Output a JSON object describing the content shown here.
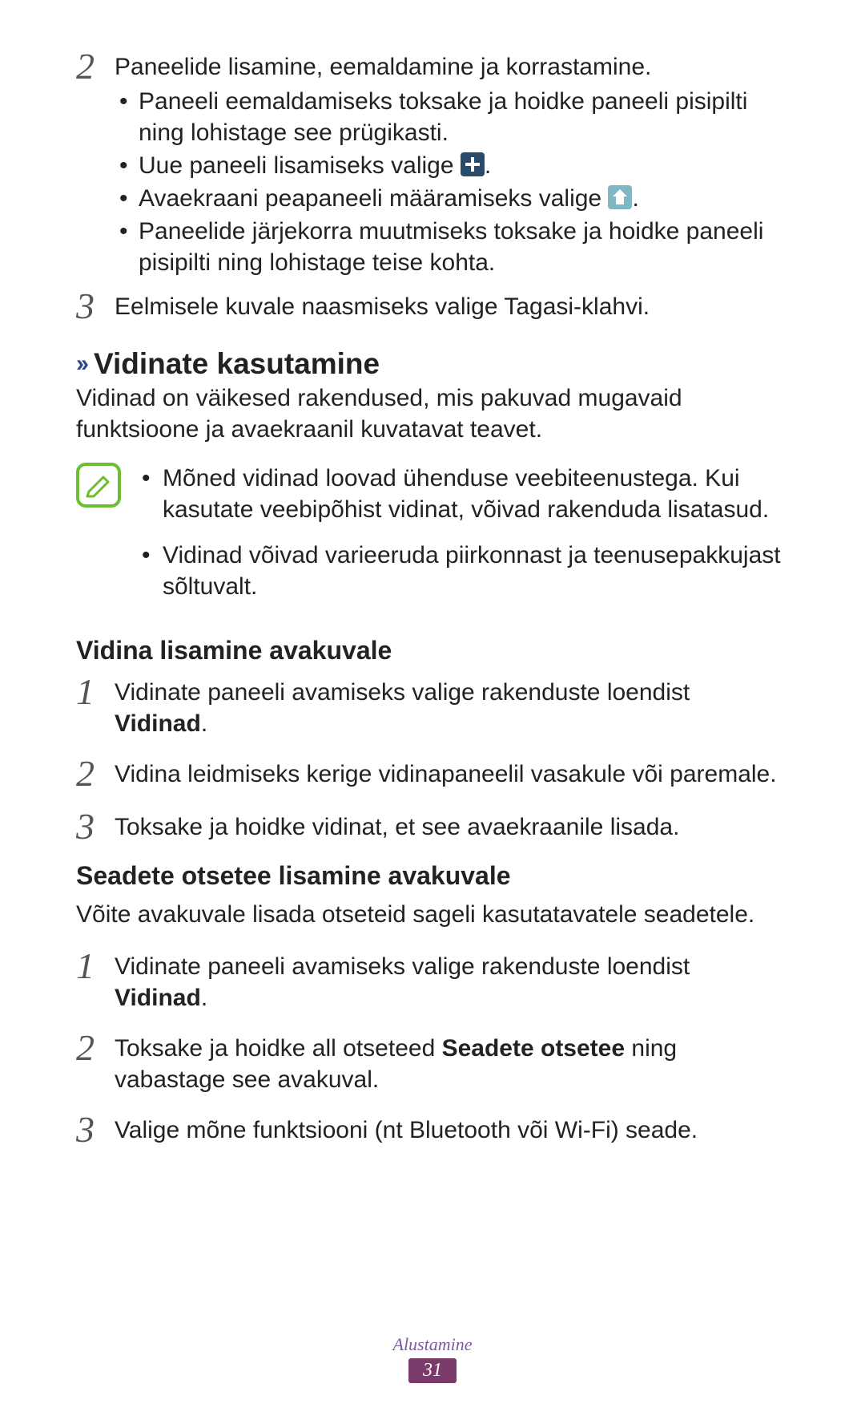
{
  "step2": {
    "num": "2",
    "lead": "Paneelide lisamine, eemaldamine ja korrastamine.",
    "b1": "Paneeli eemaldamiseks toksake ja hoidke paneeli pisipilti ning lohistage see prügikasti.",
    "b2_pre": "Uue paneeli lisamiseks valige ",
    "b2_post": ".",
    "b3_pre": "Avaekraani peapaneeli määramiseks valige ",
    "b3_post": ".",
    "b4": "Paneelide järjekorra muutmiseks toksake ja hoidke paneeli pisipilti ning lohistage teise kohta."
  },
  "step3": {
    "num": "3",
    "text": "Eelmisele kuvale naasmiseks valige Tagasi-klahvi."
  },
  "section1": {
    "title": "Vidinate kasutamine",
    "intro": "Vidinad on väikesed rakendused, mis pakuvad mugavaid funktsioone ja avaekraanil kuvatavat teavet."
  },
  "note": {
    "li1": "Mõned vidinad loovad ühenduse veebiteenustega. Kui kasutate veebipõhist vidinat, võivad rakenduda lisatasud.",
    "li2": "Vidinad võivad varieeruda piirkonnast ja teenusepakkujast sõltuvalt."
  },
  "sub1": {
    "title": "Vidina lisamine avakuvale",
    "s1": {
      "num": "1",
      "pre": "Vidinate paneeli avamiseks valige rakenduste loendist ",
      "bold": "Vidinad",
      "post": "."
    },
    "s2": {
      "num": "2",
      "text": "Vidina leidmiseks kerige vidinapaneelil vasakule või paremale."
    },
    "s3": {
      "num": "3",
      "text": "Toksake ja hoidke vidinat, et see avaekraanile lisada."
    }
  },
  "sub2": {
    "title": "Seadete otsetee lisamine avakuvale",
    "intro": "Võite avakuvale lisada otseteid sageli kasutatavatele seadetele.",
    "s1": {
      "num": "1",
      "pre": "Vidinate paneeli avamiseks valige rakenduste loendist ",
      "bold": "Vidinad",
      "post": "."
    },
    "s2": {
      "num": "2",
      "pre": "Toksake ja hoidke all otseteed ",
      "bold": "Seadete otsetee",
      "post": " ning vabastage see avakuval."
    },
    "s3": {
      "num": "3",
      "text": "Valige mõne funktsiooni (nt Bluetooth või Wi-Fi) seade."
    }
  },
  "footer": {
    "label": "Alustamine",
    "page": "31"
  }
}
